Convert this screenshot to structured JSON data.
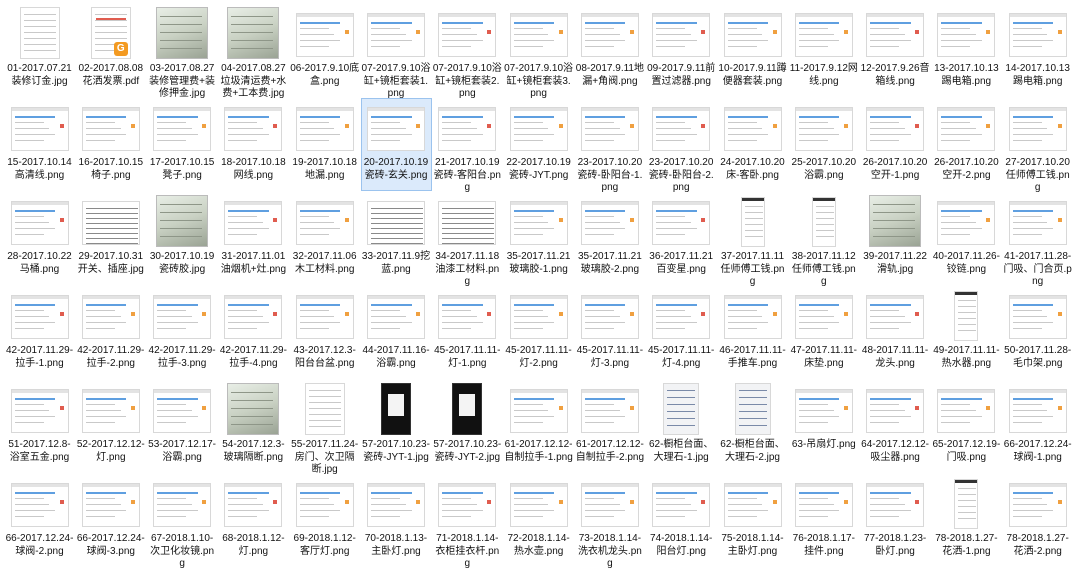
{
  "folder": {
    "selected_index": 20,
    "files": [
      {
        "name": "01-2017.07.21装修订金.jpg",
        "kind": "doc"
      },
      {
        "name": "02-2017.08.08花洒发票.pdf",
        "kind": "receipt"
      },
      {
        "name": "03-2017.08.27装修管理费+装修押金.jpg",
        "kind": "photo"
      },
      {
        "name": "04-2017.08.27垃圾清运费+水费+工本费.jpg",
        "kind": "photo"
      },
      {
        "name": "06-2017.9.10底盒.png",
        "kind": "shot"
      },
      {
        "name": "07-2017.9.10浴缸+镜柜套装1.png",
        "kind": "shot"
      },
      {
        "name": "07-2017.9.10浴缸+镜柜套装2.png",
        "kind": "shot"
      },
      {
        "name": "07-2017.9.10浴缸+镜柜套装3.png",
        "kind": "shot"
      },
      {
        "name": "08-2017.9.11地漏+角阀.png",
        "kind": "shot"
      },
      {
        "name": "09-2017.9.11前置过滤器.png",
        "kind": "shot"
      },
      {
        "name": "10-2017.9.11蹲便器套装.png",
        "kind": "shot"
      },
      {
        "name": "11-2017.9.12网线.png",
        "kind": "shot"
      },
      {
        "name": "12-2017.9.26音箱线.png",
        "kind": "shot"
      },
      {
        "name": "13-2017.10.13踢电箱.png",
        "kind": "shot"
      },
      {
        "name": "14-2017.10.13踢电箱.png",
        "kind": "list"
      },
      {
        "name": "15-2017.10.14高清线.png",
        "kind": "shot"
      },
      {
        "name": "16-2017.10.15椅子.png",
        "kind": "shot"
      },
      {
        "name": "17-2017.10.15凳子.png",
        "kind": "shot"
      },
      {
        "name": "18-2017.10.18网线.png",
        "kind": "shot"
      },
      {
        "name": "19-2017.10.18地漏.png",
        "kind": "shot"
      },
      {
        "name": "20-2017.10.19瓷砖-玄关.png",
        "kind": "shot"
      },
      {
        "name": "21-2017.10.19瓷砖-客阳台.png",
        "kind": "shot"
      },
      {
        "name": "22-2017.10.19瓷砖-JYT.png",
        "kind": "shot"
      },
      {
        "name": "23-2017.10.20瓷砖-卧阳台-1.png",
        "kind": "shot"
      },
      {
        "name": "23-2017.10.20瓷砖-卧阳台-2.png",
        "kind": "shot"
      },
      {
        "name": "24-2017.10.20床-客卧.png",
        "kind": "shot"
      },
      {
        "name": "25-2017.10.20浴霸.png",
        "kind": "shot"
      },
      {
        "name": "26-2017.10.20空开-1.png",
        "kind": "shot"
      },
      {
        "name": "26-2017.10.20空开-2.png",
        "kind": "shot"
      },
      {
        "name": "27-2017.10.20任师傅工钱.png",
        "kind": "list"
      },
      {
        "name": "28-2017.10.22马桶.png",
        "kind": "shot"
      },
      {
        "name": "29-2017.10.31开关、插座.jpg",
        "kind": "table"
      },
      {
        "name": "30-2017.10.19瓷砖胶.jpg",
        "kind": "photo"
      },
      {
        "name": "31-2017.11.01油烟机+灶.png",
        "kind": "shot"
      },
      {
        "name": "32-2017.11.06木工材料.png",
        "kind": "shot"
      },
      {
        "name": "33-2017.11.9挖蓝.png",
        "kind": "table"
      },
      {
        "name": "34-2017.11.18油漆工材料.png",
        "kind": "table"
      },
      {
        "name": "35-2017.11.21玻璃胶-1.png",
        "kind": "shot"
      },
      {
        "name": "35-2017.11.21玻璃胶-2.png",
        "kind": "shot"
      },
      {
        "name": "36-2017.11.21百变星.png",
        "kind": "shot"
      },
      {
        "name": "37-2017.11.11任师傅工钱.png",
        "kind": "phone"
      },
      {
        "name": "38-2017.11.12任师傅工钱.png",
        "kind": "phone"
      },
      {
        "name": "39-2017.11.22滑轨.jpg",
        "kind": "photo"
      },
      {
        "name": "40-2017.11.26-铰链.png",
        "kind": "shot"
      },
      {
        "name": "41-2017.11.28-门吸、门合页.png",
        "kind": "shot"
      },
      {
        "name": "42-2017.11.29-拉手-1.png",
        "kind": "shot"
      },
      {
        "name": "42-2017.11.29-拉手-2.png",
        "kind": "shot"
      },
      {
        "name": "42-2017.11.29-拉手-3.png",
        "kind": "shot"
      },
      {
        "name": "42-2017.11.29-拉手-4.png",
        "kind": "shot"
      },
      {
        "name": "43-2017.12.3-阳台台盆.png",
        "kind": "shot"
      },
      {
        "name": "44-2017.11.16-浴霸.png",
        "kind": "shot"
      },
      {
        "name": "45-2017.11.11-灯-1.png",
        "kind": "shot"
      },
      {
        "name": "45-2017.11.11-灯-2.png",
        "kind": "shot"
      },
      {
        "name": "45-2017.11.11-灯-3.png",
        "kind": "shot"
      },
      {
        "name": "45-2017.11.11-灯-4.png",
        "kind": "shot"
      },
      {
        "name": "46-2017.11.11-手推车.png",
        "kind": "shot"
      },
      {
        "name": "47-2017.11.11-床垫.png",
        "kind": "shot"
      },
      {
        "name": "48-2017.11.11-龙头.png",
        "kind": "shot"
      },
      {
        "name": "49-2017.11.11-热水器.png",
        "kind": "phone"
      },
      {
        "name": "50-2017.11.28-毛巾架.png",
        "kind": "shot"
      },
      {
        "name": "51-2017.12.8-浴室五金.png",
        "kind": "shot"
      },
      {
        "name": "52-2017.12.12-灯.png",
        "kind": "shot"
      },
      {
        "name": "53-2017.12.17-浴霸.png",
        "kind": "shot"
      },
      {
        "name": "54-2017.12.3-玻璃隔断.png",
        "kind": "photo"
      },
      {
        "name": "55-2017.11.24-房门、次卫隔断.jpg",
        "kind": "receipt"
      },
      {
        "name": "57-2017.10.23-瓷砖-JYT-1.jpg",
        "kind": "dark"
      },
      {
        "name": "57-2017.10.23-瓷砖-JYT-2.jpg",
        "kind": "dark"
      },
      {
        "name": "61-2017.12.12-自制拉手-1.png",
        "kind": "shot"
      },
      {
        "name": "61-2017.12.12-自制拉手-2.png",
        "kind": "shot"
      },
      {
        "name": "62-橱柜台面、大理石-1.jpg",
        "kind": "sketch"
      },
      {
        "name": "62-橱柜台面、大理石-2.jpg",
        "kind": "sketch"
      },
      {
        "name": "63-吊扇灯.png",
        "kind": "shot"
      },
      {
        "name": "64-2017.12.12-吸尘器.png",
        "kind": "shot"
      },
      {
        "name": "65-2017.12.19-门吸.png",
        "kind": "shot"
      },
      {
        "name": "66-2017.12.24-球阀-1.png",
        "kind": "shot"
      },
      {
        "name": "66-2017.12.24-球阀-2.png",
        "kind": "shot"
      },
      {
        "name": "66-2017.12.24-球阀-3.png",
        "kind": "shot"
      },
      {
        "name": "67-2018.1.10-次卫化妆镜.png",
        "kind": "shot"
      },
      {
        "name": "68-2018.1.12-灯.png",
        "kind": "shot"
      },
      {
        "name": "69-2018.1.12-客厅灯.png",
        "kind": "shot"
      },
      {
        "name": "70-2018.1.13-主卧灯.png",
        "kind": "shot"
      },
      {
        "name": "71-2018.1.14-衣柜挂衣杆.png",
        "kind": "shot"
      },
      {
        "name": "72-2018.1.14-热水壶.png",
        "kind": "shot"
      },
      {
        "name": "73-2018.1.14-洗衣机龙头.png",
        "kind": "shot"
      },
      {
        "name": "74-2018.1.14-阳台灯.png",
        "kind": "shot"
      },
      {
        "name": "75-2018.1.14-主卧灯.png",
        "kind": "shot"
      },
      {
        "name": "76-2018.1.17-挂件.png",
        "kind": "shot"
      },
      {
        "name": "77-2018.1.23-卧灯.png",
        "kind": "shot"
      },
      {
        "name": "78-2018.1.27-花洒-1.png",
        "kind": "phone"
      },
      {
        "name": "78-2018.1.27-花洒-2.png",
        "kind": "shot"
      }
    ]
  }
}
